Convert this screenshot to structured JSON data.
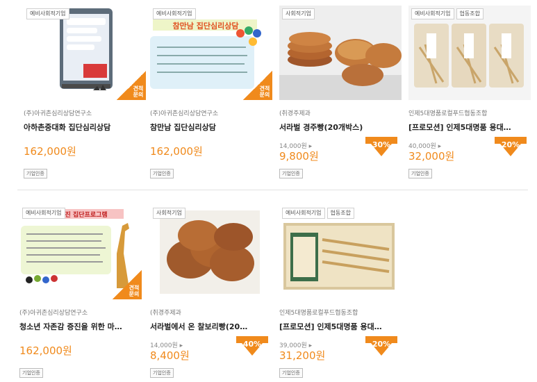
{
  "colors": {
    "accent": "#f08a1c",
    "price": "#f08a1c"
  },
  "products": [
    {
      "tags": [
        "예비사회적기업"
      ],
      "corner": "견적문의",
      "seller": "(주)아귀촌심리상담연구소",
      "title": "아하촌중대화 집단심리상담",
      "original_price": "",
      "price": "162,000원",
      "discount": "",
      "badge": "기업인증",
      "thumb_icon": "chat-poster-image"
    },
    {
      "tags": [
        "예비사회적기업"
      ],
      "corner": "견적문의",
      "seller": "(주)아귀촌심리상담연구소",
      "title": "참만남 집단심리상담",
      "original_price": "",
      "price": "162,000원",
      "discount": "",
      "badge": "기업인증",
      "thumb_icon": "group-poster-image",
      "thumb_heading": "참만남 집단심리상담"
    },
    {
      "tags": [
        "사회적기업"
      ],
      "corner": "",
      "seller": "(취경주제과",
      "title": "서라벌 경주빵(20개박스)",
      "original_price": "14,000원 ▸",
      "price": "9,800원",
      "discount": "30%",
      "badge": "기업인증",
      "thumb_icon": "bread-image"
    },
    {
      "tags": [
        "예비사회적기업",
        "협동조합"
      ],
      "corner": "",
      "seller": "인제5대명품로컬푸드협동조합",
      "title": "[프로모션] 인제5대명품 용대…",
      "original_price": "40,000원 ▸",
      "price": "32,000원",
      "discount": "20%",
      "badge": "기업인증",
      "thumb_icon": "dried-fish-bags-image"
    },
    {
      "tags": [
        "예비사회적기업"
      ],
      "corner": "견적문의",
      "seller": "(주)아귀촌심리상담연구소",
      "title": "청소년 자존감 증진을 위한 마…",
      "original_price": "",
      "price": "162,000원",
      "discount": "",
      "badge": "기업인증",
      "thumb_icon": "giraffe-poster-image",
      "thumb_heading": "자존감 증진 집단프로그램"
    },
    {
      "tags": [
        "사회적기업"
      ],
      "corner": "",
      "seller": "(취경주제과",
      "title": "서라벌에서 온 찰보리빵(20…",
      "original_price": "14,000원 ▸",
      "price": "8,400원",
      "discount": "40%",
      "badge": "기업인증",
      "thumb_icon": "pancake-stack-image"
    },
    {
      "tags": [
        "예비사회적기업",
        "협동조합"
      ],
      "corner": "",
      "seller": "인제5대명품로컬푸드협동조합",
      "title": "[프로모션] 인제5대명품 용대…",
      "original_price": "39,000원 ▸",
      "price": "31,200원",
      "discount": "20%",
      "badge": "기업인증",
      "thumb_icon": "dried-fish-box-image"
    }
  ]
}
